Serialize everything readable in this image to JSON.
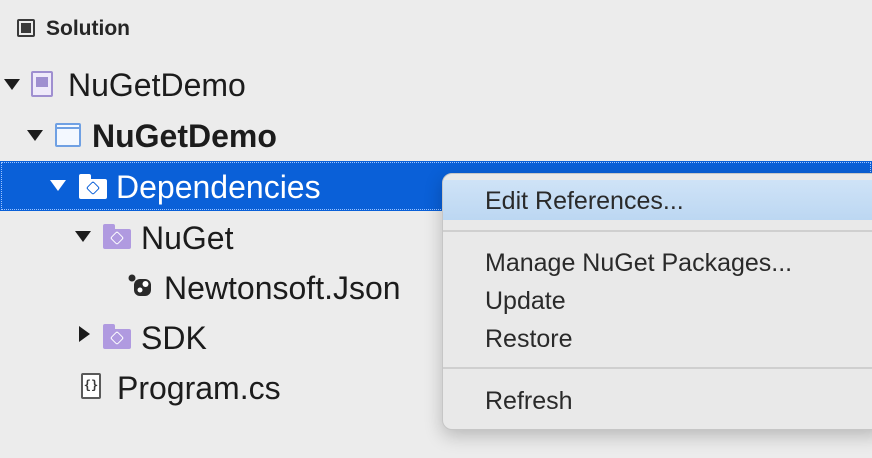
{
  "pad": {
    "title": "Solution",
    "icon": "solution-pad-icon"
  },
  "tree": {
    "solution": {
      "label": "NuGetDemo",
      "icon": "solution-icon",
      "expanded": true
    },
    "project": {
      "label": "NuGetDemo",
      "icon": "project-icon",
      "expanded": true
    },
    "dependencies": {
      "label": "Dependencies",
      "icon": "dependencies-folder-icon",
      "expanded": true,
      "selected": true
    },
    "nuget": {
      "label": "NuGet",
      "icon": "nuget-folder-icon",
      "expanded": true
    },
    "newtonsoft": {
      "label": "Newtonsoft.Json",
      "icon": "nuget-package-icon"
    },
    "sdk": {
      "label": "SDK",
      "icon": "sdk-folder-icon",
      "expanded": false
    },
    "program": {
      "label": "Program.cs",
      "icon": "csharp-file-icon"
    }
  },
  "context_menu": {
    "items": [
      {
        "label": "Edit References...",
        "highlighted": true
      },
      {
        "label": "Manage NuGet Packages..."
      },
      {
        "label": "Update"
      },
      {
        "label": "Restore"
      },
      {
        "label": "Refresh"
      }
    ]
  },
  "colors": {
    "selection": "#0a60d8",
    "background": "#ececec",
    "folder": "#b09ae0",
    "menu_highlight": "#c6ddf4"
  }
}
